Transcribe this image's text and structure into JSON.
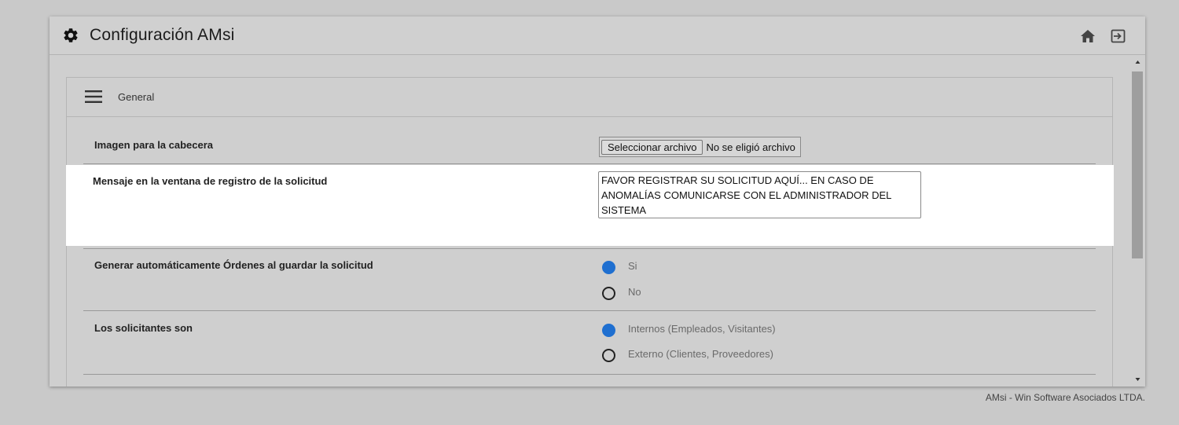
{
  "window": {
    "title": "Configuración AMsi",
    "icons": {
      "title": "gear-icon",
      "home": "home-icon",
      "exit": "exit-icon"
    }
  },
  "panel": {
    "title": "General",
    "icon": "menu-icon"
  },
  "rows": {
    "header_image": {
      "label": "Imagen para la cabecera",
      "file_button": "Seleccionar archivo",
      "file_status": "No se eligió archivo"
    },
    "message": {
      "label": "Mensaje en la ventana de registro de la solicitud",
      "value": "FAVOR REGISTRAR SU SOLICITUD AQUÍ... EN CASO DE ANOMALÍAS COMUNICARSE CON EL ADMINISTRADOR DEL SISTEMA"
    },
    "auto_orders": {
      "label": "Generar automáticamente Órdenes al guardar la solicitud",
      "options": [
        {
          "label": "Si",
          "checked": true
        },
        {
          "label": "No",
          "checked": false
        }
      ]
    },
    "requesters": {
      "label": "Los solicitantes son",
      "options": [
        {
          "label": "Internos (Empleados, Visitantes)",
          "checked": true
        },
        {
          "label": "Externo (Clientes, Proveedores)",
          "checked": false
        }
      ]
    }
  },
  "footer": {
    "text": "AMsi - Win Software Asociados LTDA."
  },
  "colors": {
    "accent": "#1f6fd0",
    "background": "#c9c9c9",
    "highlight_row": "#ffffff"
  }
}
